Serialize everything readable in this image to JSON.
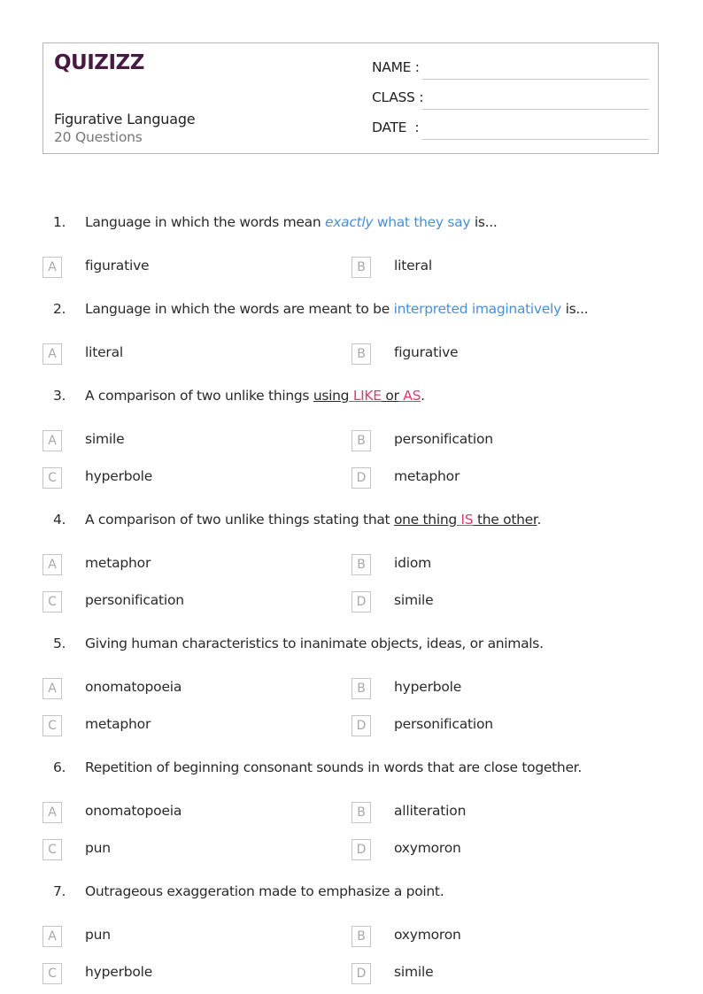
{
  "header": {
    "logo": "QUIZIZZ",
    "title": "Figurative Language",
    "subtitle": "20 Questions",
    "fields": [
      {
        "label": "NAME :"
      },
      {
        "label": "CLASS :"
      },
      {
        "label": "DATE  :"
      }
    ]
  },
  "questions": [
    {
      "number": "1.",
      "text_parts": [
        "Language in which the words mean ",
        "exactly",
        " what they say",
        " is..."
      ],
      "options": [
        {
          "letter": "A",
          "text": "figurative"
        },
        {
          "letter": "B",
          "text": "literal"
        }
      ]
    },
    {
      "number": "2.",
      "text_parts": [
        "Language in which the words are meant to be ",
        "interpreted imaginatively",
        " is..."
      ],
      "options": [
        {
          "letter": "A",
          "text": "literal"
        },
        {
          "letter": "B",
          "text": "figurative"
        }
      ]
    },
    {
      "number": "3.",
      "text_parts": [
        "A comparison of two unlike things ",
        "using",
        " LIKE",
        " or",
        " AS",
        "."
      ],
      "options": [
        {
          "letter": "A",
          "text": "simile"
        },
        {
          "letter": "B",
          "text": "personification"
        },
        {
          "letter": "C",
          "text": "hyperbole"
        },
        {
          "letter": "D",
          "text": "metaphor"
        }
      ]
    },
    {
      "number": "4.",
      "text_parts": [
        "A comparison of two unlike things stating that ",
        "one thing",
        " IS",
        " the other",
        "."
      ],
      "options": [
        {
          "letter": "A",
          "text": "metaphor"
        },
        {
          "letter": "B",
          "text": "idiom"
        },
        {
          "letter": "C",
          "text": "personification"
        },
        {
          "letter": "D",
          "text": "simile"
        }
      ]
    },
    {
      "number": "5.",
      "text_parts": [
        "Giving human characteristics to inanimate objects, ideas, or animals."
      ],
      "options": [
        {
          "letter": "A",
          "text": "onomatopoeia"
        },
        {
          "letter": "B",
          "text": "hyperbole"
        },
        {
          "letter": "C",
          "text": "metaphor"
        },
        {
          "letter": "D",
          "text": "personification"
        }
      ]
    },
    {
      "number": "6.",
      "text_parts": [
        "Repetition of beginning consonant sounds in words that are close together."
      ],
      "options": [
        {
          "letter": "A",
          "text": "onomatopoeia"
        },
        {
          "letter": "B",
          "text": "alliteration"
        },
        {
          "letter": "C",
          "text": "pun"
        },
        {
          "letter": "D",
          "text": "oxymoron"
        }
      ]
    },
    {
      "number": "7.",
      "text_parts": [
        "Outrageous exaggeration made to emphasize a point."
      ],
      "options": [
        {
          "letter": "A",
          "text": "pun"
        },
        {
          "letter": "B",
          "text": "oxymoron"
        },
        {
          "letter": "C",
          "text": "hyperbole"
        },
        {
          "letter": "D",
          "text": "simile"
        }
      ]
    }
  ],
  "colors": {
    "brand": "#461a42",
    "highlight_blue": "#4a8fd6",
    "highlight_pink": "#e0396e"
  }
}
